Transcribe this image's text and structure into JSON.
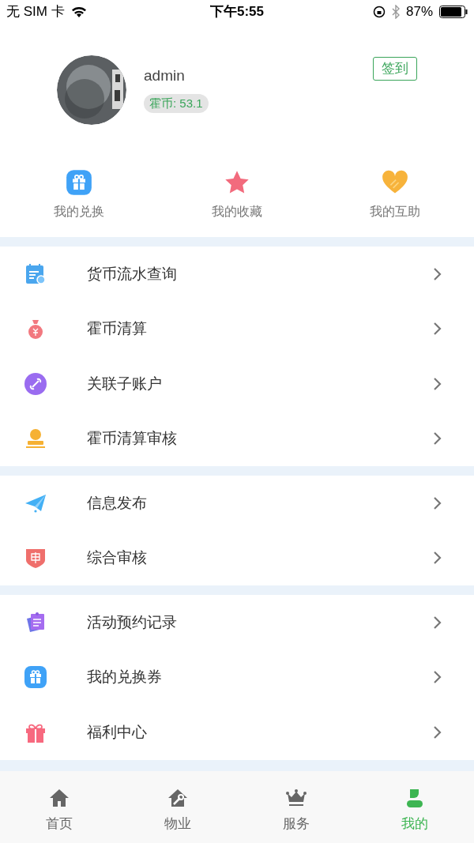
{
  "status_bar": {
    "carrier": "无 SIM 卡",
    "time": "下午5:55",
    "battery": "87%"
  },
  "profile": {
    "username": "admin",
    "coins": "霍币: 53.1",
    "checkin_button": "签到"
  },
  "shortcuts": [
    {
      "label": "我的兑换",
      "kind": "gift"
    },
    {
      "label": "我的收藏",
      "kind": "star"
    },
    {
      "label": "我的互助",
      "kind": "heart"
    }
  ],
  "menu_groups": [
    [
      {
        "label": "货币流水查询",
        "kind": "ledger"
      },
      {
        "label": "霍币清算",
        "kind": "moneybag"
      },
      {
        "label": "关联子账户",
        "kind": "link"
      },
      {
        "label": "霍币清算审核",
        "kind": "stamp"
      }
    ],
    [
      {
        "label": "信息发布",
        "kind": "plane"
      },
      {
        "label": "综合审核",
        "kind": "shield"
      }
    ],
    [
      {
        "label": "活动预约记录",
        "kind": "notes"
      },
      {
        "label": "我的兑换券",
        "kind": "gift"
      },
      {
        "label": "福利中心",
        "kind": "present"
      }
    ]
  ],
  "tab_bar": [
    {
      "label": "首页",
      "kind": "home",
      "selected": false
    },
    {
      "label": "物业",
      "kind": "repair",
      "selected": false
    },
    {
      "label": "服务",
      "kind": "crown",
      "selected": false
    },
    {
      "label": "我的",
      "kind": "person",
      "selected": true
    }
  ]
}
